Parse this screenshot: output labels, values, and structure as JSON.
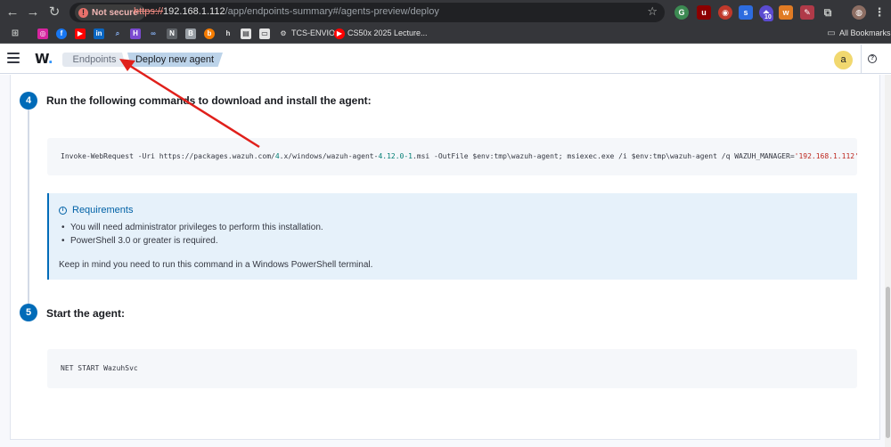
{
  "browser": {
    "security_label": "Not secure",
    "url_scheme": "https://",
    "url_host": "192.168.1.112",
    "url_path": "/app/endpoints-summary#/agents-preview/deploy",
    "extension_badge": "10",
    "bookmarks": [
      {
        "label": "TCS-ENVIO"
      },
      {
        "label": "CS50x 2025 Lecture..."
      }
    ],
    "all_bookmarks_label": "All Bookmarks"
  },
  "header": {
    "logo": "W",
    "breadcrumbs": [
      "Endpoints",
      "Deploy new agent"
    ],
    "avatar_initial": "a"
  },
  "steps": [
    {
      "number": "4",
      "title": "Run the following commands to download and install the agent:",
      "command_pre": "Invoke-WebRequest -Uri https://packages.wazuh.com/",
      "command_ver1": "4",
      "command_mid1": ".x/windows/wazuh-agent-",
      "command_ver2": "4.12.0-1",
      "command_mid2": ".msi -OutFile $env:tmp\\wazuh-agent; msiexec.exe /i $env:tmp\\wazuh-agent /q WAZUH_MANAGER=",
      "command_manager": "'192.168.1.112'"
    },
    {
      "number": "5",
      "title": "Start the agent:",
      "command": "NET START WazuhSvc"
    }
  ],
  "requirements": {
    "title": "Requirements",
    "items": [
      "You will need administrator privileges to perform this installation.",
      "PowerShell 3.0 or greater is required."
    ],
    "note": "Keep in mind you need to run this command in a Windows PowerShell terminal."
  }
}
